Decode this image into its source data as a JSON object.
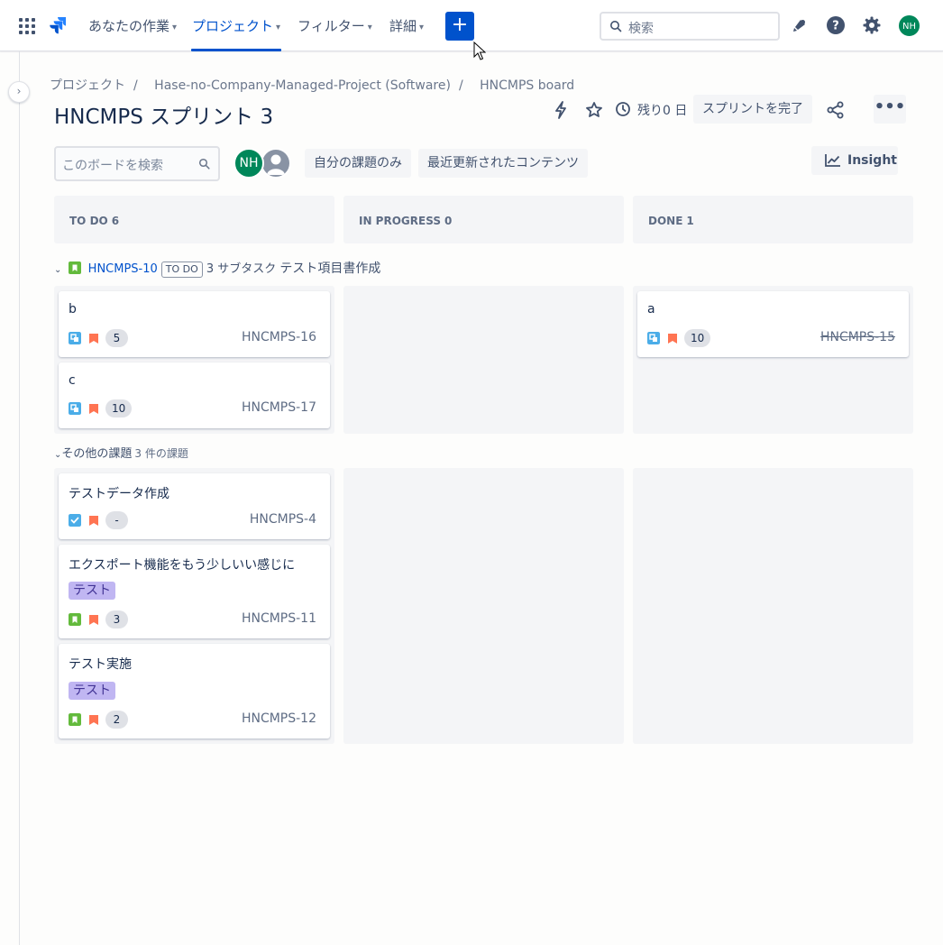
{
  "nav": {
    "items": [
      {
        "label": "あなたの作業"
      },
      {
        "label": "プロジェクト"
      },
      {
        "label": "フィルター"
      },
      {
        "label": "詳細"
      }
    ],
    "search_placeholder": "検索",
    "user_initials": "NH"
  },
  "breadcrumb": [
    "プロジェクト",
    "Hase-no-Company-Managed-Project (Software)",
    "HNCMPS board"
  ],
  "sprint": {
    "title": "HNCMPS スプリント 3",
    "remaining": "残り0 日",
    "complete_label": "スプリントを完了",
    "more_label": "•••"
  },
  "toolbar": {
    "search_placeholder": "このボードを検索",
    "avatar_initials": "NH",
    "filters": [
      "自分の課題のみ",
      "最近更新されたコンテンツ"
    ],
    "insight_label": "Insight"
  },
  "columns": [
    {
      "name": "TO DO",
      "count": "6"
    },
    {
      "name": "IN PROGRESS",
      "count": "0"
    },
    {
      "name": "DONE",
      "count": "1"
    }
  ],
  "swimlane1": {
    "key": "HNCMPS-10",
    "status": "TO DO",
    "subtasks": "3 サブタスク",
    "summary": "テスト項目書作成"
  },
  "cards_lane1": {
    "todo": [
      {
        "summary": "b",
        "points": "5",
        "key": "HNCMPS-16"
      },
      {
        "summary": "c",
        "points": "10",
        "key": "HNCMPS-17"
      }
    ],
    "done": [
      {
        "summary": "a",
        "points": "10",
        "key": "HNCMPS-15"
      }
    ]
  },
  "swimlane2": {
    "label": "その他の課題",
    "count": "3 件の課題"
  },
  "cards_lane2": [
    {
      "summary": "テストデータ作成",
      "points": "-",
      "key": "HNCMPS-4",
      "type": "task"
    },
    {
      "summary": "エクスポート機能をもう少しいい感じに",
      "label": "テスト",
      "points": "3",
      "key": "HNCMPS-11",
      "type": "story"
    },
    {
      "summary": "テスト実施",
      "label": "テスト",
      "points": "2",
      "key": "HNCMPS-12",
      "type": "story"
    }
  ],
  "colors": {
    "primary": "#0052cc",
    "avatar": "#00875a",
    "story": "#63ba3c",
    "subtask": "#4bade8",
    "priority": "#ff7452",
    "label": "#c0b6f2"
  }
}
